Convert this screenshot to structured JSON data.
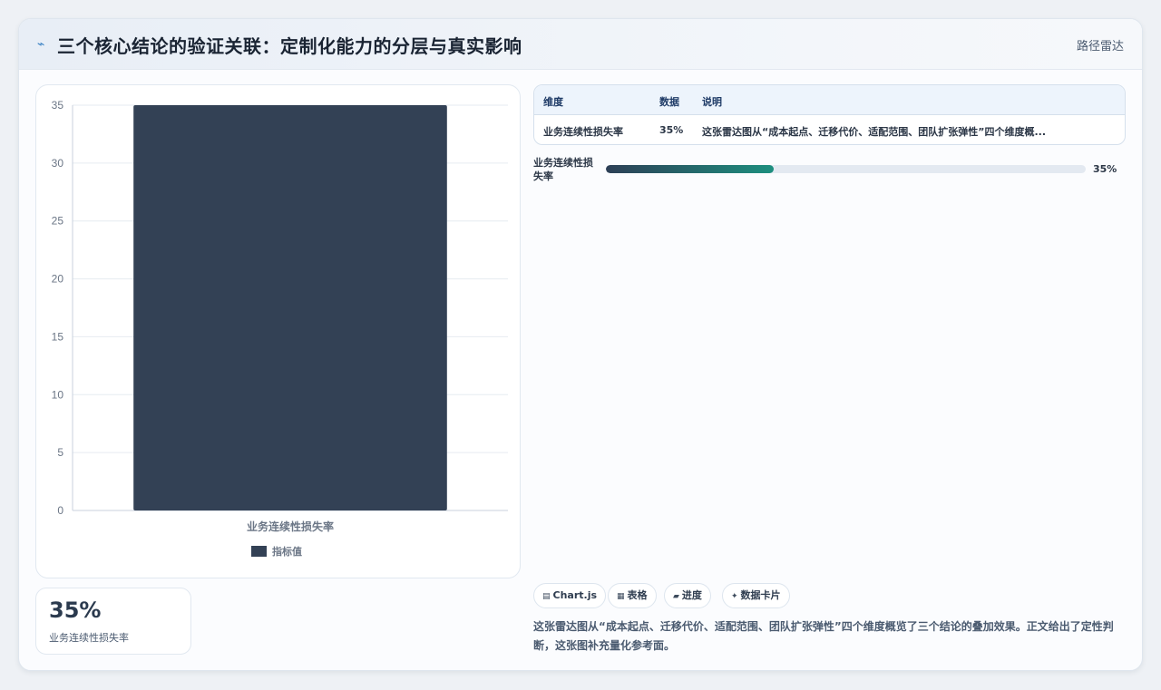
{
  "header": {
    "icon": "lightning-icon",
    "title": "三个核心结论的验证关联：定制化能力的分层与真实影响",
    "link_label": "路径雷达"
  },
  "chart_data": {
    "type": "bar",
    "categories": [
      "业务连续性损失率"
    ],
    "series": [
      {
        "name": "指标值",
        "values": [
          35
        ],
        "color": "#334155"
      }
    ],
    "xlabel": "",
    "ylabel": "",
    "ylim": [
      0,
      35
    ],
    "yticks": [
      0,
      5,
      10,
      15,
      20,
      25,
      30,
      35
    ],
    "grid": true,
    "legend": "bottom"
  },
  "stat": {
    "value": "35%",
    "label": "业务连续性损失率"
  },
  "table": {
    "headers": [
      "维度",
      "数据",
      "说明"
    ],
    "rows": [
      [
        "业务连续性损失率",
        "35%",
        "这张雷达图从“成本起点、迁移代价、适配范围、团队扩张弹性”四个维度概..."
      ]
    ]
  },
  "progress": {
    "label": "业务连续性损失率",
    "value_text": "35%",
    "fraction": 0.35
  },
  "chips": [
    {
      "icon": "chart-icon",
      "glyph": "▤",
      "label": "Chart.js"
    },
    {
      "icon": "table-icon",
      "glyph": "▦",
      "label": "表格"
    },
    {
      "icon": "progress-icon",
      "glyph": "▰",
      "label": "进度"
    },
    {
      "icon": "sparkle-icon",
      "glyph": "✦",
      "label": "数据卡片"
    }
  ],
  "description": "这张雷达图从“成本起点、迁移代价、适配范围、团队扩张弹性”四个维度概览了三个结论的叠加效果。正文给出了定性判断，这张图补充量化参考面。",
  "colors": {
    "bar": "#334155",
    "accent": "#1d8f7f",
    "header_icon": "#3b82c4"
  }
}
